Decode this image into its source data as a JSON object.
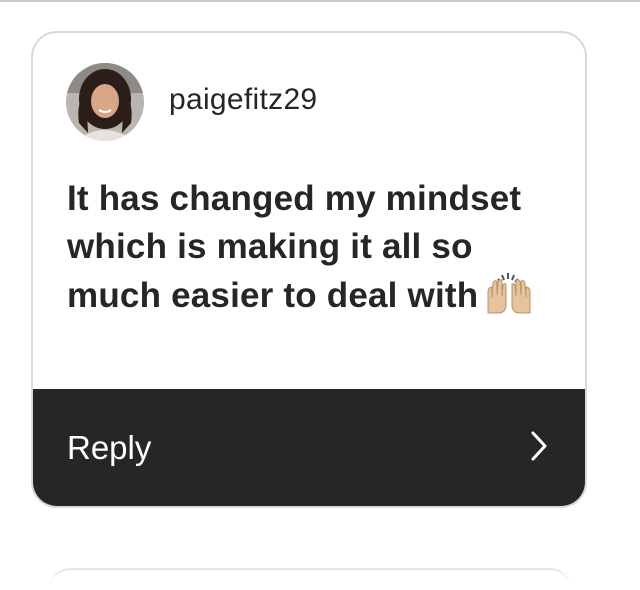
{
  "comment": {
    "username": "paigefitz29",
    "message": "It has changed my mindset which is making it all so much easier to deal with",
    "emoji": "raising-hands"
  },
  "reply": {
    "label": "Reply",
    "icon": "chevron-right-icon"
  },
  "colors": {
    "reply_bar": "#262626",
    "text": "#262626",
    "card_border": "#d9d9d9"
  }
}
